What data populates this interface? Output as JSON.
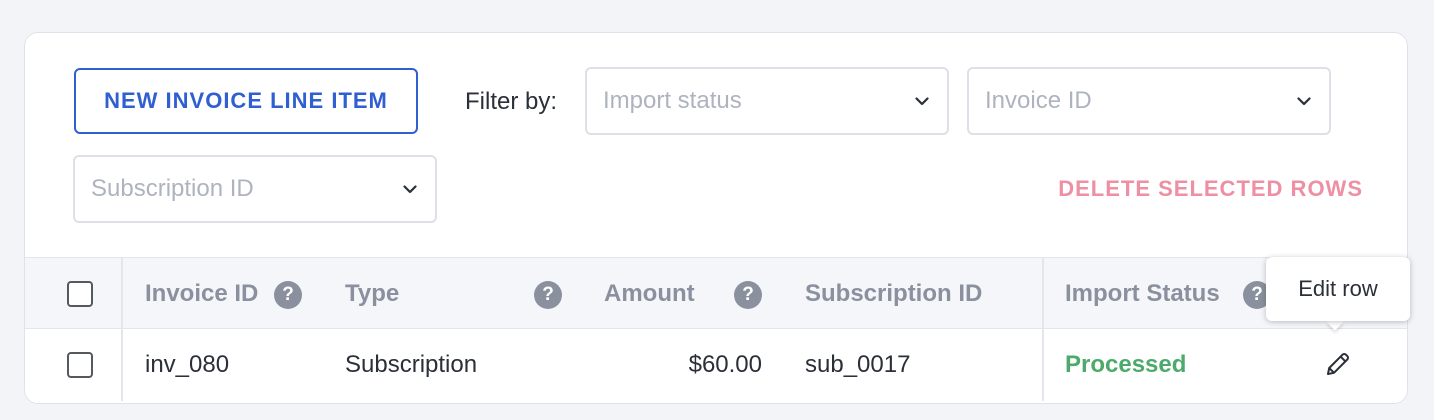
{
  "toolbar": {
    "new_item_label": "NEW INVOICE LINE ITEM",
    "filter_label": "Filter by:",
    "filters": [
      {
        "placeholder": "Import status"
      },
      {
        "placeholder": "Invoice ID"
      },
      {
        "placeholder": "Subscription ID"
      }
    ],
    "delete_label": "DELETE SELECTED ROWS"
  },
  "table": {
    "columns": [
      {
        "label": "Invoice ID",
        "has_help": true
      },
      {
        "label": "Type",
        "has_help": true
      },
      {
        "label": "Amount",
        "has_help": true
      },
      {
        "label": "Subscription ID",
        "has_help": false
      },
      {
        "label": "Import Status",
        "has_help": true
      }
    ],
    "help_glyph": "?",
    "rows": [
      {
        "invoice_id": "inv_080",
        "type": "Subscription",
        "amount": "$60.00",
        "subscription_id": "sub_0017",
        "import_status": "Processed",
        "selected": false
      }
    ]
  },
  "tooltip": {
    "text": "Edit row"
  },
  "icons": {
    "chevron": "chevron-down-icon",
    "help": "help-circle-icon",
    "edit": "pencil-icon"
  },
  "colors": {
    "primary": "#2f5fd0",
    "danger_muted": "#ee8fa3",
    "success": "#4caa6a",
    "header_text": "#8a909e"
  }
}
